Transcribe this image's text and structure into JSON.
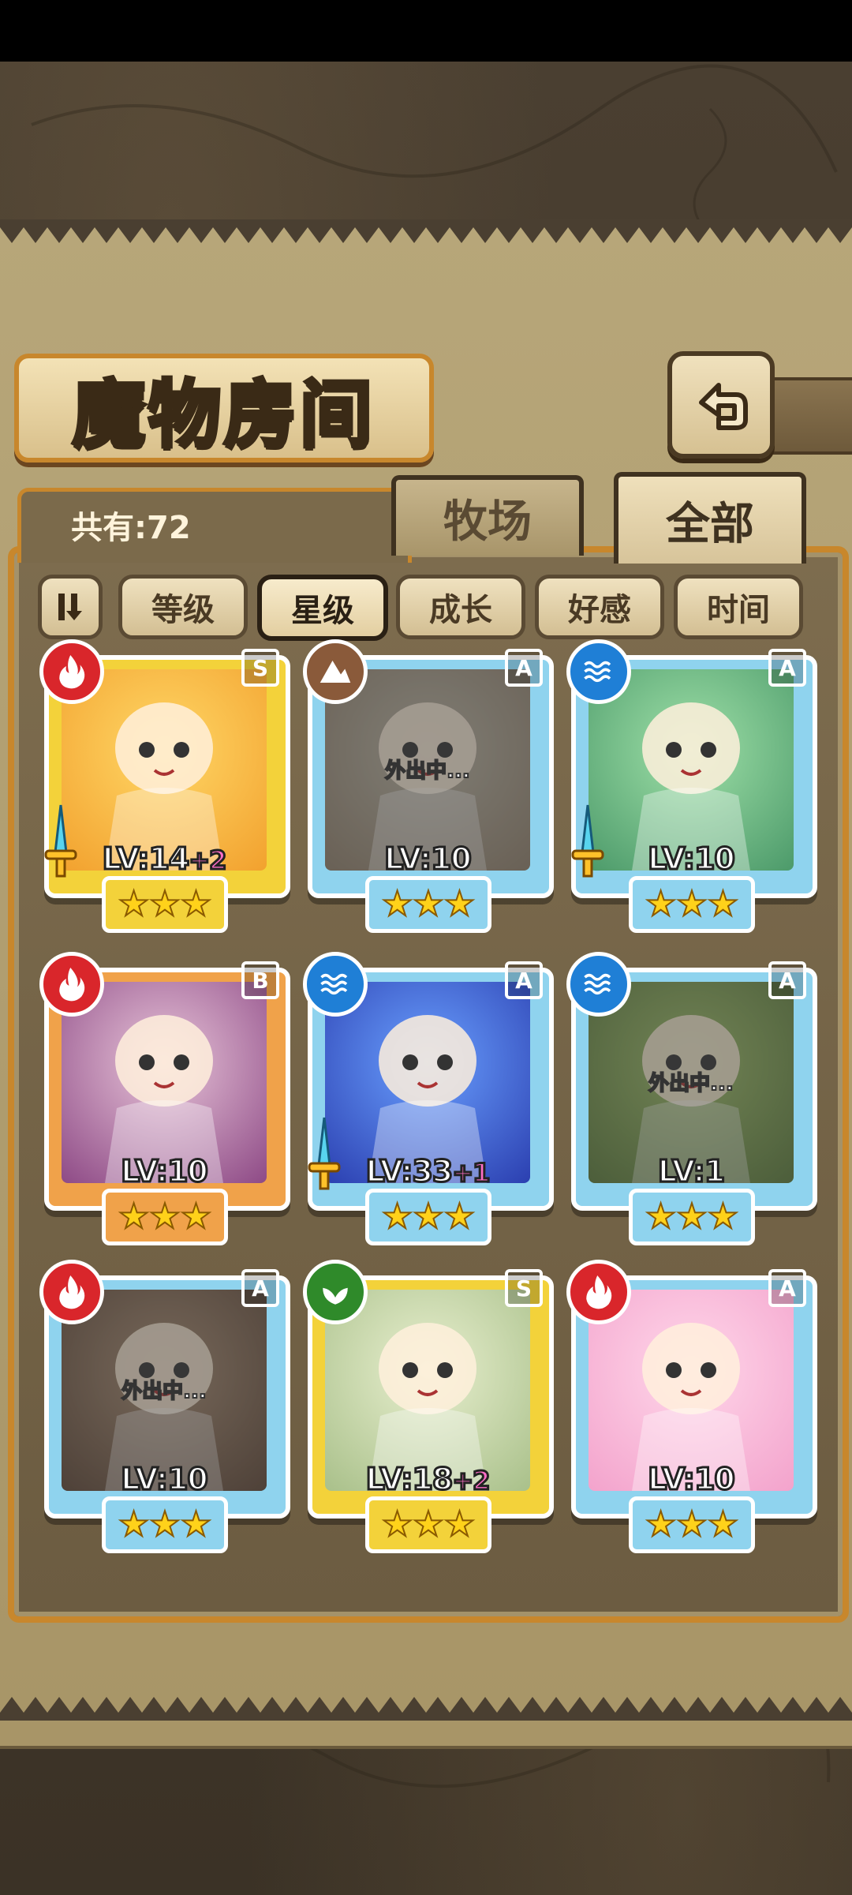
{
  "header": {
    "title": "魔物房间"
  },
  "tabs": {
    "count_label": "共有:72",
    "ranch": "牧场",
    "all": "全部"
  },
  "sort": {
    "toggle_icon": "sort-order-icon",
    "level": "等级",
    "star": "星级",
    "growth": "成长",
    "affection": "好感",
    "time": "时间",
    "active": "星级"
  },
  "monsters": [
    {
      "rank": "S",
      "element": "fire",
      "level": "LV:14",
      "bonus": "+2",
      "stars": "★★★",
      "away": "",
      "equipped": true,
      "frame_color": "#f3d23a"
    },
    {
      "rank": "A",
      "element": "earth",
      "level": "LV:10",
      "bonus": "",
      "stars": "★★★",
      "away": "外出中...",
      "equipped": false,
      "frame_color": "#8fd3ee"
    },
    {
      "rank": "A",
      "element": "water",
      "level": "LV:10",
      "bonus": "",
      "stars": "★★★",
      "away": "",
      "equipped": true,
      "frame_color": "#8fd3ee"
    },
    {
      "rank": "B",
      "element": "fire",
      "level": "LV:10",
      "bonus": "",
      "stars": "★★★",
      "away": "",
      "equipped": false,
      "frame_color": "#f0a24a"
    },
    {
      "rank": "A",
      "element": "water",
      "level": "LV:33",
      "bonus": "+1",
      "stars": "★★★",
      "away": "",
      "equipped": true,
      "frame_color": "#8fd3ee"
    },
    {
      "rank": "A",
      "element": "water",
      "level": "LV:1",
      "bonus": "",
      "stars": "★★★",
      "away": "外出中...",
      "equipped": false,
      "frame_color": "#8fd3ee"
    },
    {
      "rank": "A",
      "element": "fire",
      "level": "LV:10",
      "bonus": "",
      "stars": "★★★",
      "away": "外出中...",
      "equipped": false,
      "frame_color": "#8fd3ee"
    },
    {
      "rank": "S",
      "element": "wood",
      "level": "LV:18",
      "bonus": "+2",
      "stars": "★★★",
      "away": "",
      "equipped": false,
      "frame_color": "#f3d23a"
    },
    {
      "rank": "A",
      "element": "fire",
      "level": "LV:10",
      "bonus": "",
      "stars": "★★★",
      "away": "",
      "equipped": false,
      "frame_color": "#8fd3ee"
    }
  ]
}
